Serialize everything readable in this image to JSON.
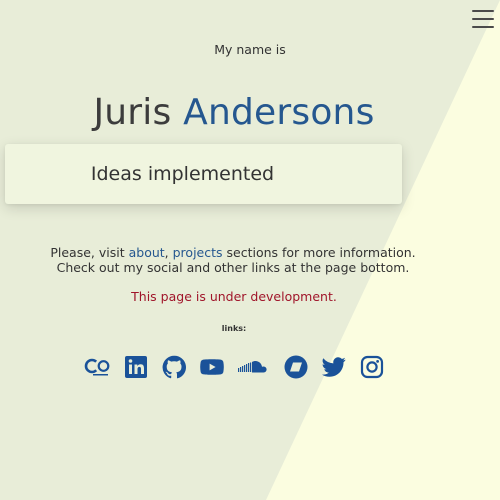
{
  "header": {
    "menu_icon": "hamburger-menu-icon"
  },
  "intro": {
    "text": "My name is"
  },
  "name": {
    "first": "Juris",
    "last": "Andersons",
    "first_color": "#3c3c3c",
    "last_color": "#25578f"
  },
  "card": {
    "text": "Ideas implemented"
  },
  "visit": {
    "prefix": "Please, visit ",
    "about_link": "about",
    "separator": ", ",
    "projects_link": "projects",
    "suffix": " sections for more information.",
    "line2": "Check out my social and other links at the page bottom."
  },
  "dev_notice": {
    "text": "This page is under development.",
    "color": "#a0152a"
  },
  "links": {
    "label": "links:",
    "icons": [
      "cv-icon",
      "linkedin-icon",
      "github-icon",
      "youtube-icon",
      "soundcloud-icon",
      "bandcamp-icon",
      "twitter-icon",
      "instagram-icon"
    ],
    "icon_color": "#1a5299"
  },
  "colors": {
    "background": "#e8edd8",
    "diagonal": "#fbfde0",
    "card": "#f0f5df"
  }
}
